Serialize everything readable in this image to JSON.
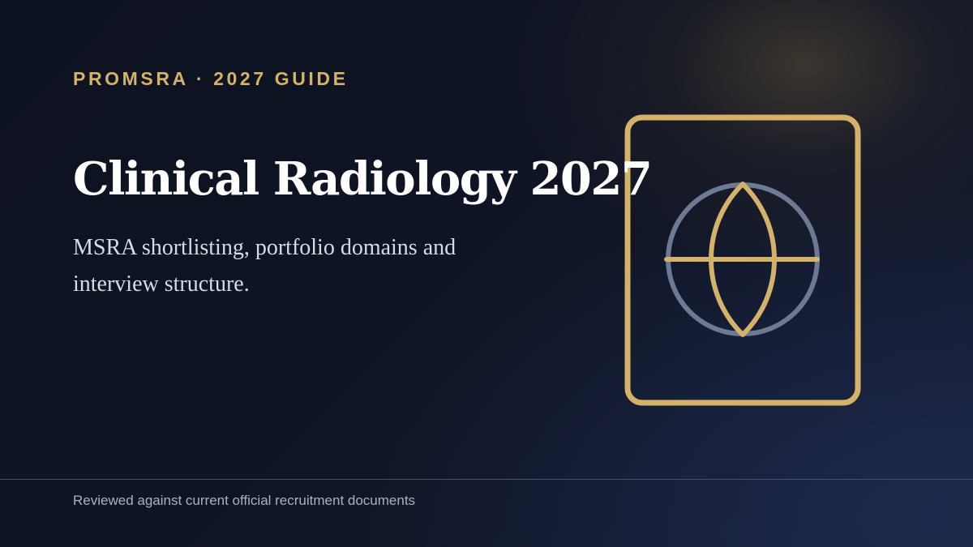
{
  "header": {
    "eyebrow": "PROMSRA · 2027 GUIDE"
  },
  "hero": {
    "title": "Clinical Radiology 2027",
    "subtitle": "MSRA shortlisting, portfolio domains and interview structure."
  },
  "emblem": {
    "icon": "globe-icon",
    "frame_color": "#d4b26a",
    "circle_color": "#6c7a93"
  },
  "footer": {
    "note": "Reviewed against current official recruitment documents"
  },
  "colors": {
    "accent": "#d4b26a",
    "background": "#0f1424",
    "title": "#ffffff",
    "subtitle": "#d7dbe4",
    "footer": "#aab1c2"
  }
}
